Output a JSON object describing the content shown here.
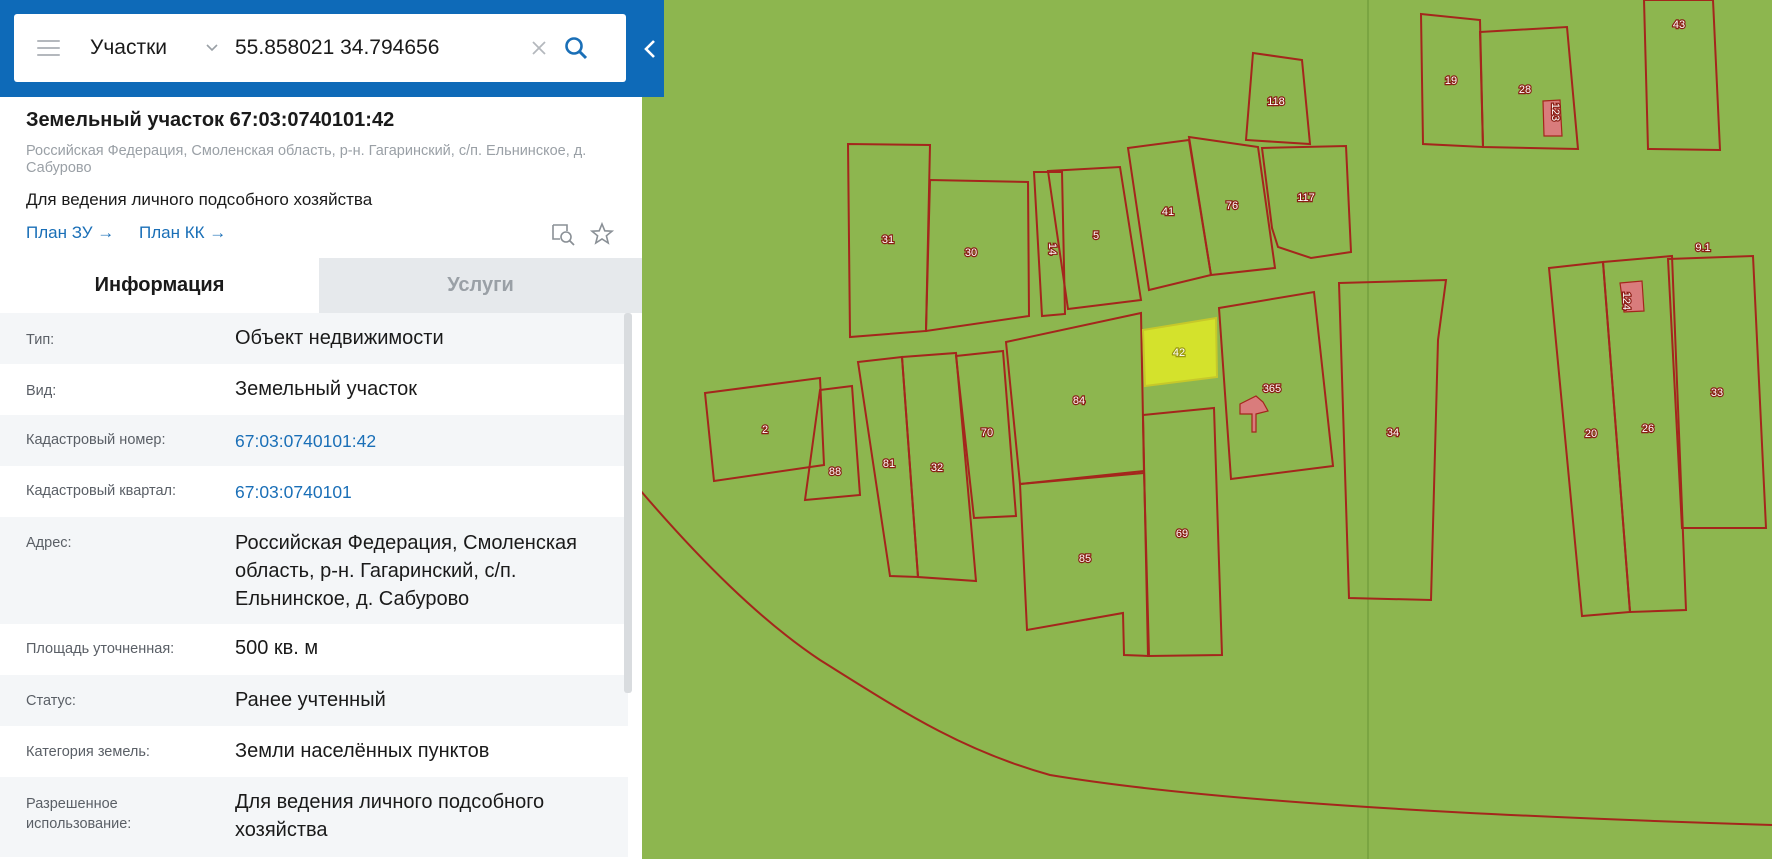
{
  "search": {
    "layer": "Участки",
    "query": "55.858021 34.794656"
  },
  "card": {
    "title": "Земельный участок 67:03:0740101:42",
    "address": "Российская Федерация, Смоленская область, р-н. Гагаринский, с/п. Ельнинское, д. Сабурово",
    "purpose": "Для ведения личного подсобного хозяйства",
    "plan_zu": "План ЗУ →",
    "plan_kk": "План КК →"
  },
  "tabs": {
    "info": "Информация",
    "services": "Услуги"
  },
  "info": {
    "type_label": "Тип:",
    "type_value": "Объект недвижимости",
    "kind_label": "Вид:",
    "kind_value": "Земельный участок",
    "cadnum_label": "Кадастровый номер:",
    "cadnum_value": "67:03:0740101:42",
    "quarter_label": "Кадастровый квартал:",
    "quarter_value": "67:03:0740101",
    "address_label": "Адрес:",
    "address_value": "Российская Федерация, Смоленская область, р-н. Гагаринский, с/п. Ельнинское, д. Сабурово",
    "area_label": "Площадь уточненная:",
    "area_value": "500 кв. м",
    "status_label": "Статус:",
    "status_value": "Ранее учтенный",
    "category_label": "Категория земель:",
    "category_value": "Земли населённых пунктов",
    "usage_label": "Разрешенное использование:",
    "usage_value": "Для ведения личного подсобного хозяйства"
  },
  "map": {
    "colors": {
      "background": "#8db64f",
      "boundary": "#a4261c",
      "highlight": "#d4e22c",
      "building": "#d97c7c",
      "panel_header": "#0e6ab8",
      "link": "#1a6fb7"
    },
    "plot_labels": {
      "p2": "2",
      "p88": "88",
      "p81": "81",
      "p32": "32",
      "p70": "70",
      "p31": "31",
      "p30": "30",
      "p14": "14",
      "p5": "5",
      "p84": "84",
      "p85": "85",
      "p42": "42",
      "p69": "69",
      "p41": "41",
      "p76": "76",
      "p117": "117",
      "p118": "118",
      "p365": "365",
      "p34": "34",
      "p19": "19",
      "p28": "28",
      "p123": "123",
      "p43": "43",
      "p20": "20",
      "p26": "26",
      "p124": "124",
      "p33": "33",
      "p91": "9.1"
    }
  }
}
